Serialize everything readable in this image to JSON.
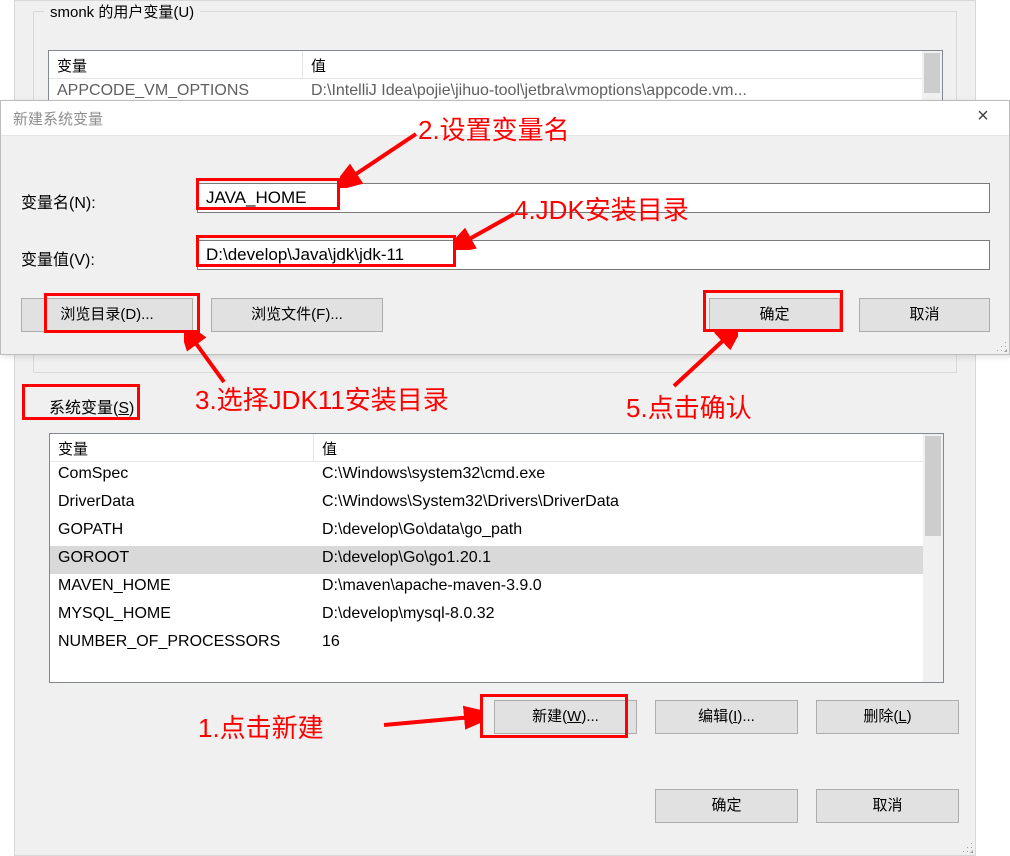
{
  "user_vars": {
    "group_title": "smonk 的用户变量(U)",
    "columns": {
      "var": "变量",
      "val": "值"
    },
    "rows": [
      {
        "name": "APPCODE_VM_OPTIONS",
        "value": "D:\\IntelliJ Idea\\pojie\\jihuo-tool\\jetbra\\vmoptions\\appcode.vm..."
      }
    ]
  },
  "sys_vars": {
    "section_label_prefix": "系统变量(",
    "section_label_u": "S",
    "section_label_suffix": ")",
    "columns": {
      "var": "变量",
      "val": "值"
    },
    "rows": [
      {
        "name": "ComSpec",
        "value": "C:\\Windows\\system32\\cmd.exe"
      },
      {
        "name": "DriverData",
        "value": "C:\\Windows\\System32\\Drivers\\DriverData"
      },
      {
        "name": "GOPATH",
        "value": "D:\\develop\\Go\\data\\go_path"
      },
      {
        "name": "GOROOT",
        "value": "D:\\develop\\Go\\go1.20.1"
      },
      {
        "name": "MAVEN_HOME",
        "value": "D:\\maven\\apache-maven-3.9.0"
      },
      {
        "name": "MYSQL_HOME",
        "value": "D:\\develop\\mysql-8.0.32"
      },
      {
        "name": "NUMBER_OF_PROCESSORS",
        "value": "16"
      }
    ],
    "selected_index": 3
  },
  "sys_buttons": {
    "new_pre": "新建(",
    "new_u": "W",
    "new_suf": ")...",
    "edit_pre": "编辑(",
    "edit_u": "I",
    "edit_suf": ")...",
    "del_pre": "删除(",
    "del_u": "L",
    "del_suf": ")"
  },
  "bottom_buttons": {
    "ok": "确定",
    "cancel": "取消"
  },
  "dialog": {
    "title": "新建系统变量",
    "close": "×",
    "name_label": "变量名(N):",
    "value_label": "变量值(V):",
    "name_value": "JAVA_HOME",
    "value_value": "D:\\develop\\Java\\jdk\\jdk-11",
    "browse_dir": "浏览目录(D)...",
    "browse_file": "浏览文件(F)...",
    "ok": "确定",
    "cancel": "取消"
  },
  "annotations": {
    "a1": "1.点击新建",
    "a2": "2.设置变量名",
    "a3": "3.选择JDK11安装目录",
    "a4": "4.JDK安装目录",
    "a5": "5.点击确认"
  }
}
